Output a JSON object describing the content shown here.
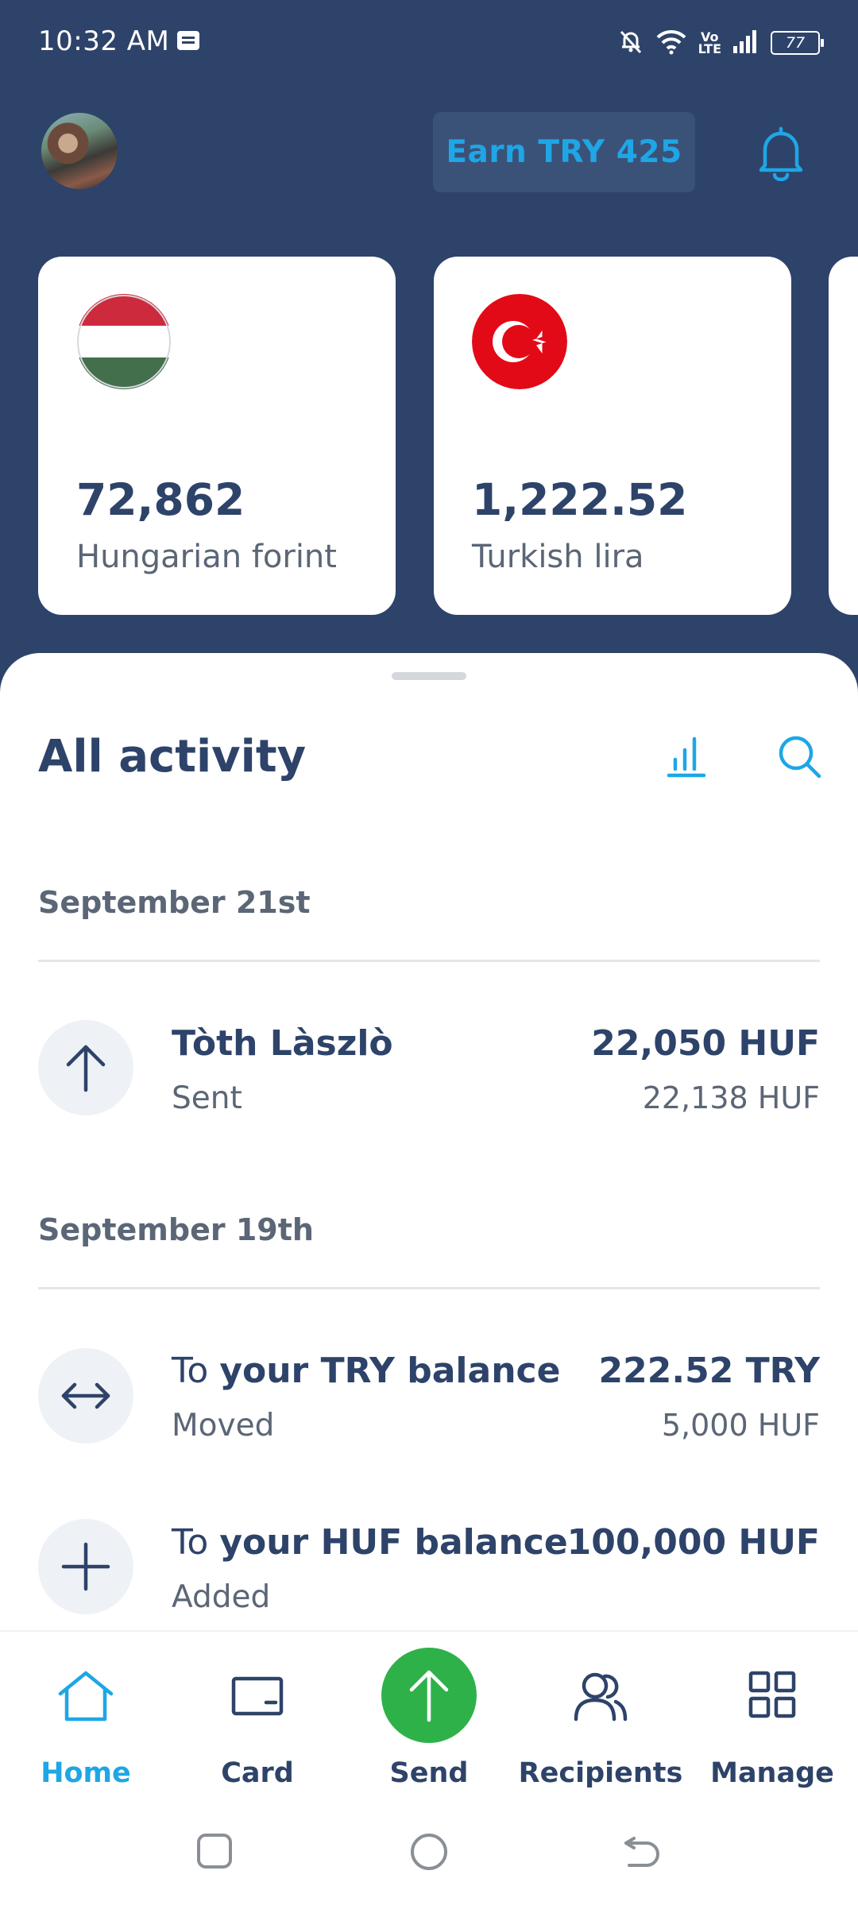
{
  "status_bar": {
    "time": "10:32 AM",
    "battery": "77",
    "volte_top": "Vo",
    "volte_bottom": "LTE",
    "icons": [
      "message-icon",
      "mute-icon",
      "wifi-icon",
      "signal-icon",
      "battery-icon"
    ]
  },
  "header": {
    "earn_label": "Earn TRY 425",
    "icons": [
      "avatar",
      "bell-icon"
    ]
  },
  "balances": [
    {
      "amount": "72,862",
      "currency": "Hungarian forint",
      "flag": "hungary-flag"
    },
    {
      "amount": "1,222.52",
      "currency": "Turkish lira",
      "flag": "turkey-flag"
    }
  ],
  "activity": {
    "title": "All activity",
    "groups": [
      {
        "date": "September 21st",
        "items": [
          {
            "icon": "arrow-up-icon",
            "title_plain": "",
            "title_bold": "Tòth Làszlò",
            "subtitle": "Sent",
            "amount": "22,050 HUF",
            "amount_secondary": "22,138 HUF"
          }
        ]
      },
      {
        "date": "September 19th",
        "items": [
          {
            "icon": "swap-icon",
            "title_plain": "To ",
            "title_bold": "your TRY balance",
            "subtitle": "Moved",
            "amount": "222.52 TRY",
            "amount_secondary": "5,000 HUF"
          },
          {
            "icon": "plus-icon",
            "title_plain": "To ",
            "title_bold": "your HUF balance",
            "subtitle": "Added",
            "amount": "100,000 HUF",
            "amount_secondary": ""
          }
        ]
      }
    ]
  },
  "bottom_nav": {
    "items": [
      {
        "label": "Home",
        "icon": "home-icon",
        "active": true
      },
      {
        "label": "Card",
        "icon": "card-icon",
        "active": false
      },
      {
        "label": "Send",
        "icon": "send-arrow-icon",
        "active": false
      },
      {
        "label": "Recipients",
        "icon": "recipients-icon",
        "active": false
      },
      {
        "label": "Manage",
        "icon": "grid-icon",
        "active": false
      }
    ]
  },
  "colors": {
    "header_bg": "#2e4369",
    "accent": "#1ea6e6",
    "send_green": "#2fb14a",
    "text_primary": "#2e4369",
    "text_secondary": "#5b6676"
  }
}
